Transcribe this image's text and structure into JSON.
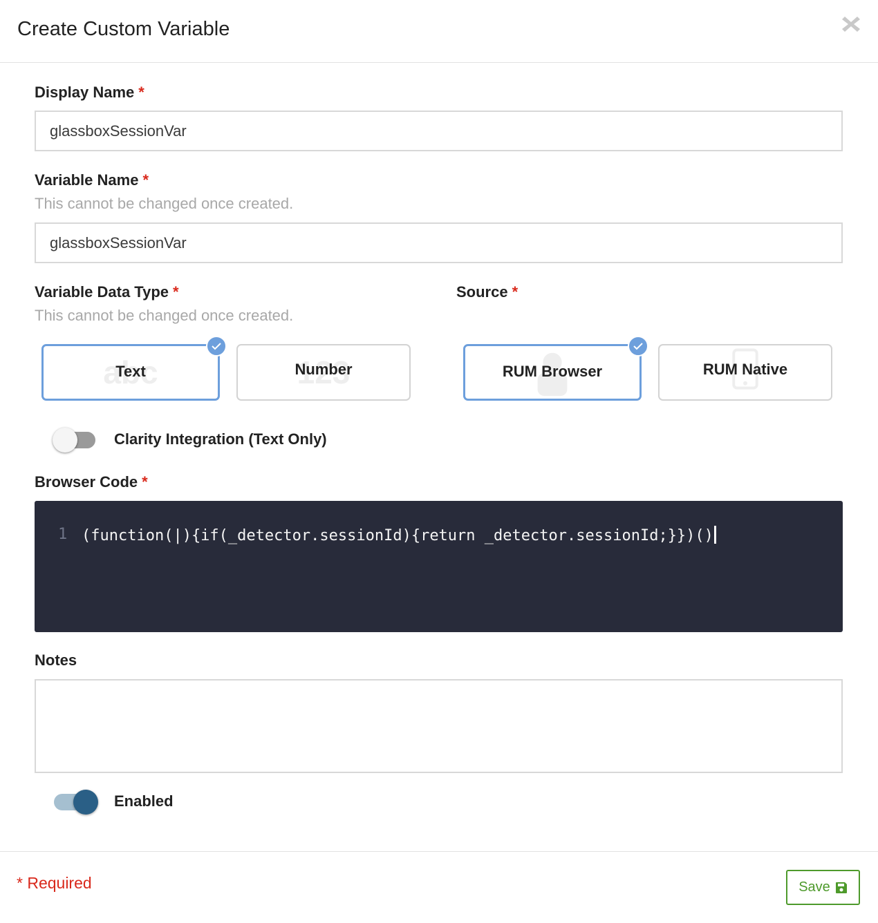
{
  "dialog": {
    "title": "Create Custom Variable"
  },
  "fields": {
    "display_name": {
      "label": "Display Name",
      "required_mark": "*",
      "value": "glassboxSessionVar"
    },
    "variable_name": {
      "label": "Variable Name",
      "required_mark": "*",
      "hint": "This cannot be changed once created.",
      "value": "glassboxSessionVar"
    },
    "data_type": {
      "label": "Variable Data Type",
      "required_mark": "*",
      "hint": "This cannot be changed once created.",
      "options": [
        {
          "label": "Text",
          "ghost": "abc",
          "selected": true
        },
        {
          "label": "Number",
          "ghost": "123",
          "selected": false
        }
      ]
    },
    "source": {
      "label": "Source",
      "required_mark": "*",
      "options": [
        {
          "label": "RUM Browser",
          "icon": "person-icon",
          "selected": true
        },
        {
          "label": "RUM Native",
          "icon": "mobile-phone-icon",
          "selected": false
        }
      ]
    },
    "clarity": {
      "label": "Clarity Integration (Text Only)",
      "enabled": false
    },
    "browser_code": {
      "label": "Browser Code",
      "required_mark": "*",
      "line_number": "1",
      "code": "(function(|){if(_detector.sessionId){return _detector.sessionId;}})()"
    },
    "notes": {
      "label": "Notes",
      "value": ""
    },
    "enabled": {
      "label": "Enabled",
      "enabled": true
    }
  },
  "footer": {
    "required_note": "* Required",
    "save_label": "Save",
    "save_icon": "floppy-disk-icon"
  },
  "colors": {
    "accent_blue": "#6d9fdc",
    "required_red": "#d9291c",
    "save_green": "#4e9a2b",
    "code_bg": "#282b3a",
    "toggle_on": "#2a5f86"
  }
}
